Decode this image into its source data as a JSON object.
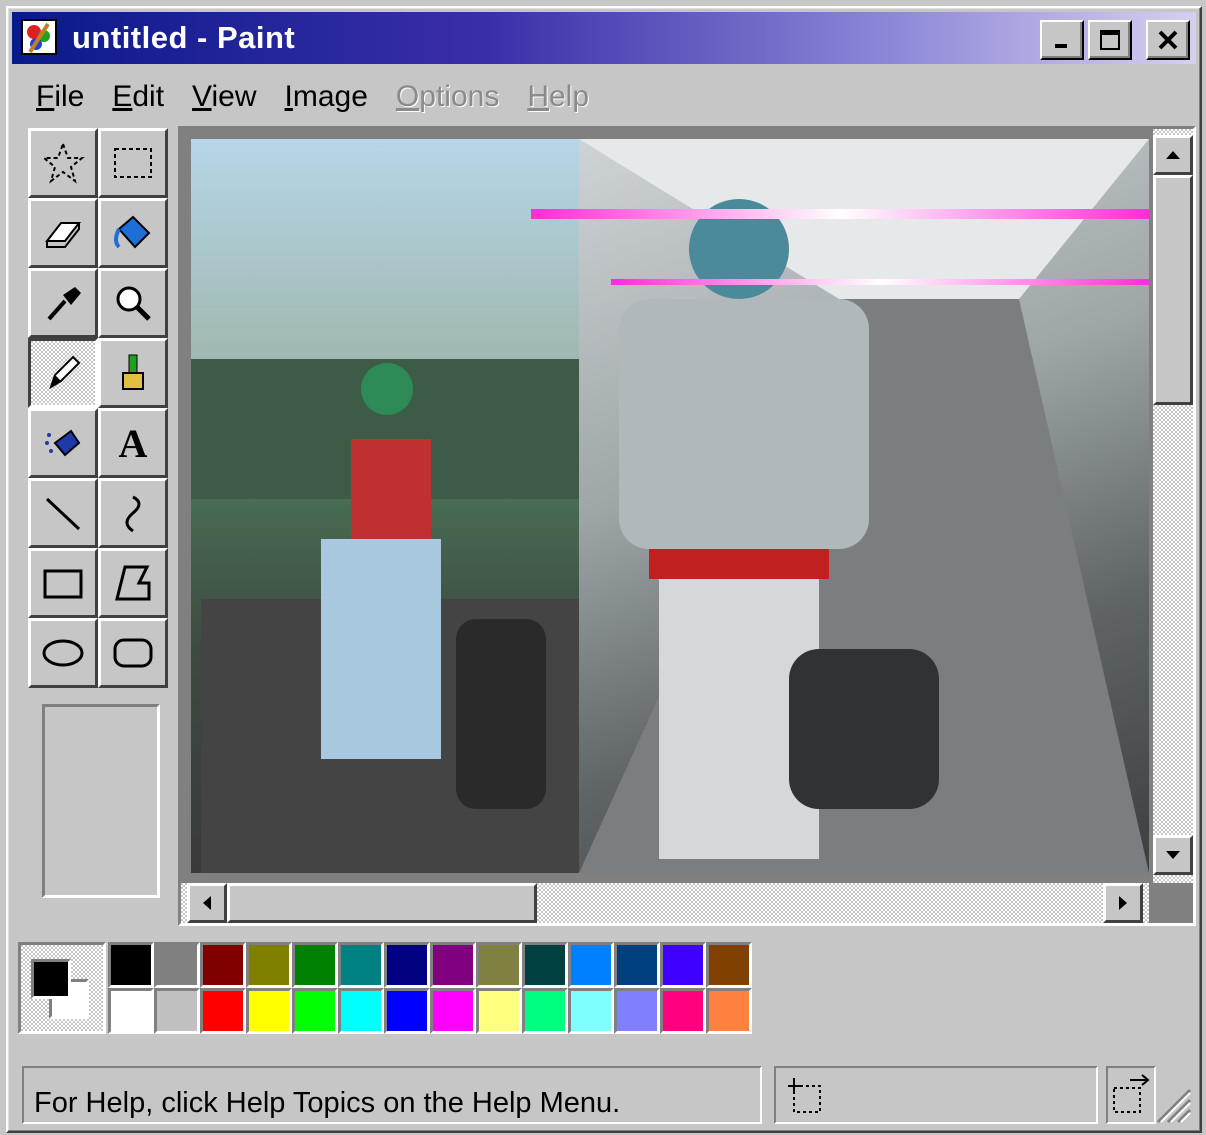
{
  "window": {
    "title": "untitled - Paint"
  },
  "title_buttons": [
    "minimize",
    "maximize",
    "close"
  ],
  "menu": [
    {
      "label": "File",
      "mnemonic": "F",
      "rest": "ile",
      "enabled": true
    },
    {
      "label": "Edit",
      "mnemonic": "E",
      "rest": "dit",
      "enabled": true
    },
    {
      "label": "View",
      "mnemonic": "V",
      "rest": "iew",
      "enabled": true
    },
    {
      "label": "Image",
      "mnemonic": "I",
      "rest": "mage",
      "enabled": true
    },
    {
      "label": "Options",
      "mnemonic": "O",
      "rest": "ptions",
      "enabled": false
    },
    {
      "label": "Help",
      "mnemonic": "H",
      "rest": "elp",
      "enabled": false
    }
  ],
  "tools": [
    {
      "name": "free-form-select",
      "icon": "star-select-icon",
      "selected": false
    },
    {
      "name": "rect-select",
      "icon": "dashed-rect-icon",
      "selected": false
    },
    {
      "name": "eraser",
      "icon": "eraser-icon",
      "selected": false
    },
    {
      "name": "fill",
      "icon": "paint-bucket-icon",
      "selected": false
    },
    {
      "name": "pick-color",
      "icon": "eyedropper-icon",
      "selected": false
    },
    {
      "name": "magnifier",
      "icon": "magnifier-icon",
      "selected": false
    },
    {
      "name": "pencil",
      "icon": "pencil-icon",
      "selected": true
    },
    {
      "name": "brush",
      "icon": "brush-icon",
      "selected": false
    },
    {
      "name": "airbrush",
      "icon": "airbrush-icon",
      "selected": false
    },
    {
      "name": "text",
      "icon": "text-a-icon",
      "label": "A",
      "selected": false
    },
    {
      "name": "line",
      "icon": "line-icon",
      "selected": false
    },
    {
      "name": "curve",
      "icon": "curve-icon",
      "selected": false
    },
    {
      "name": "rectangle",
      "icon": "rectangle-icon",
      "selected": false
    },
    {
      "name": "polygon",
      "icon": "polygon-icon",
      "selected": false
    },
    {
      "name": "ellipse",
      "icon": "ellipse-icon",
      "selected": false
    },
    {
      "name": "rounded-rectangle",
      "icon": "rounded-rect-icon",
      "selected": false
    }
  ],
  "colors": {
    "foreground": "#000000",
    "background": "#ffffff",
    "palette_top": [
      "#000000",
      "#808080",
      "#800000",
      "#808000",
      "#008000",
      "#008080",
      "#000080",
      "#800080",
      "#808040",
      "#004040",
      "#0080ff",
      "#004080",
      "#4000ff",
      "#804000"
    ],
    "palette_bottom": [
      "#ffffff",
      "#c0c0c0",
      "#ff0000",
      "#ffff00",
      "#00ff00",
      "#00ffff",
      "#0000ff",
      "#ff00ff",
      "#ffff80",
      "#00ff80",
      "#80ffff",
      "#8080ff",
      "#ff0080",
      "#ff8040"
    ]
  },
  "status": {
    "help_text": "For Help, click Help Topics on the Help Menu."
  }
}
